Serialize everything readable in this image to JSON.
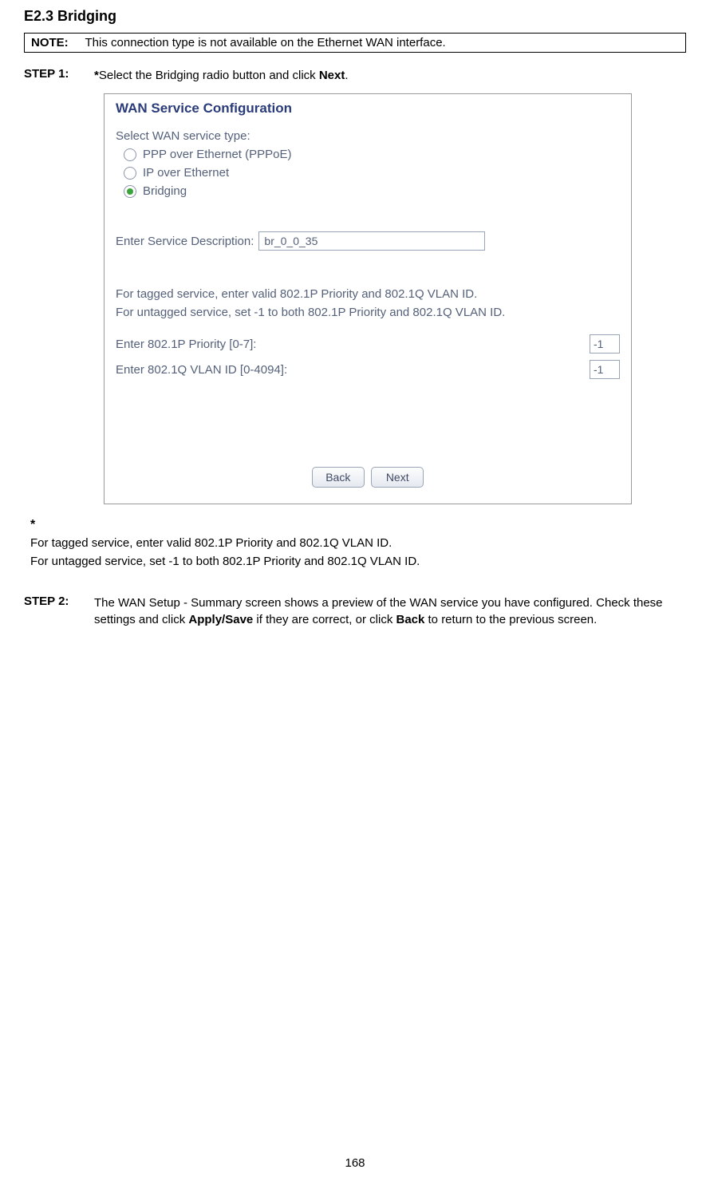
{
  "section_title": "E2.3 Bridging",
  "note": {
    "label": "NOTE",
    "text": "This connection type is not available on the Ethernet WAN interface."
  },
  "step1": {
    "label": "STEP 1:",
    "star": "*",
    "text_before": "Select the Bridging radio button and click ",
    "bold": "Next",
    "text_after": "."
  },
  "figure": {
    "title": "WAN Service Configuration",
    "select_label": "Select WAN service type:",
    "radios": [
      {
        "label": "PPP over Ethernet (PPPoE)",
        "checked": false
      },
      {
        "label": "IP over Ethernet",
        "checked": false
      },
      {
        "label": "Bridging",
        "checked": true
      }
    ],
    "desc_label": "Enter Service Description:",
    "desc_value": "br_0_0_35",
    "tag_text_line1": "For tagged service, enter valid 802.1P Priority and 802.1Q VLAN ID.",
    "tag_text_line2": "For untagged service, set -1 to both 802.1P Priority and 802.1Q VLAN ID.",
    "priority_label": "Enter 802.1P Priority [0-7]:",
    "priority_value": "-1",
    "vlan_label": "Enter 802.1Q VLAN ID [0-4094]:",
    "vlan_value": "-1",
    "back_btn": "Back",
    "next_btn": "Next"
  },
  "after": {
    "star": "*",
    "line1": "For tagged service, enter valid 802.1P Priority and 802.1Q VLAN ID.",
    "line2": "For untagged service, set -1 to both 802.1P Priority and 802.1Q VLAN ID."
  },
  "step2": {
    "label": "STEP 2:",
    "seg1": "The WAN Setup - Summary screen shows a preview of the WAN service you have configured. Check these settings and click ",
    "bold1": "Apply/Save",
    "seg2": " if they are correct, or click ",
    "bold2": "Back",
    "seg3": " to return to the previous screen."
  },
  "page_number": "168"
}
